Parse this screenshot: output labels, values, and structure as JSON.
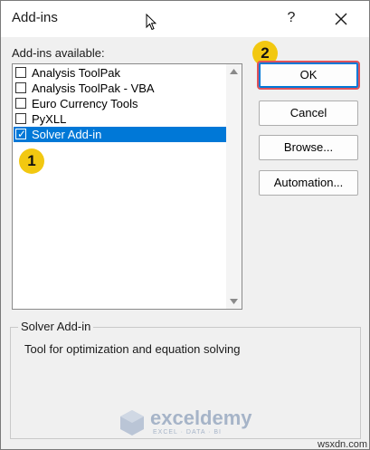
{
  "dialog": {
    "title": "Add-ins",
    "help_label": "?"
  },
  "list": {
    "label": "Add-ins available:",
    "items": [
      {
        "label": "Analysis ToolPak",
        "checked": false,
        "selected": false
      },
      {
        "label": "Analysis ToolPak - VBA",
        "checked": false,
        "selected": false
      },
      {
        "label": "Euro Currency Tools",
        "checked": false,
        "selected": false
      },
      {
        "label": "PyXLL",
        "checked": false,
        "selected": false
      },
      {
        "label": "Solver Add-in",
        "checked": true,
        "selected": true
      }
    ]
  },
  "buttons": {
    "ok": "OK",
    "cancel": "Cancel",
    "browse": "Browse...",
    "automation": "Automation..."
  },
  "description": {
    "title": "Solver Add-in",
    "text": "Tool for optimization and equation solving"
  },
  "annotations": {
    "step1": "1",
    "step2": "2"
  },
  "watermark": {
    "name": "exceldemy",
    "tagline": "EXCEL · DATA · BI",
    "site": "wsxdn.com"
  },
  "colors": {
    "selection": "#0078d7",
    "badge": "#f2c811",
    "ok_highlight": "#e0525a"
  }
}
